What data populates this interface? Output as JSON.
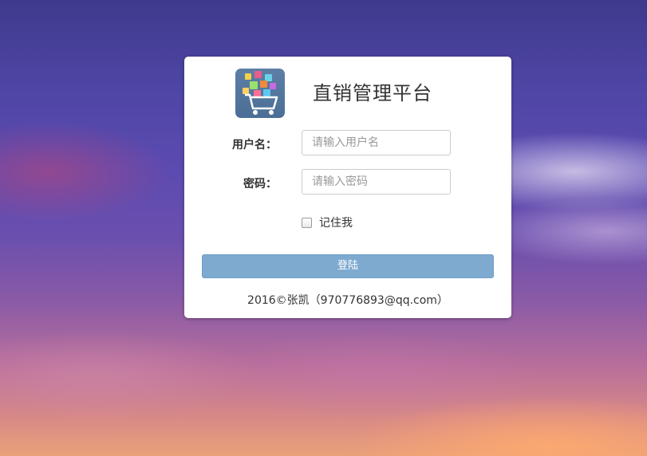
{
  "app": {
    "title": "直销管理平台",
    "logo_icon": "shopping-cart-logo-icon"
  },
  "form": {
    "username_label": "用户名：",
    "username_placeholder": "请输入用户名",
    "password_label": "密码：",
    "password_placeholder": "请输入密码",
    "remember_label": "记住我",
    "remember_checked": false,
    "login_button": "登陆"
  },
  "footer": {
    "text": "2016©张凯（970776893@qq.com）"
  },
  "colors": {
    "button": "#7eaad0",
    "card": "#ffffff",
    "logo_bg": "#5d7fa6"
  }
}
